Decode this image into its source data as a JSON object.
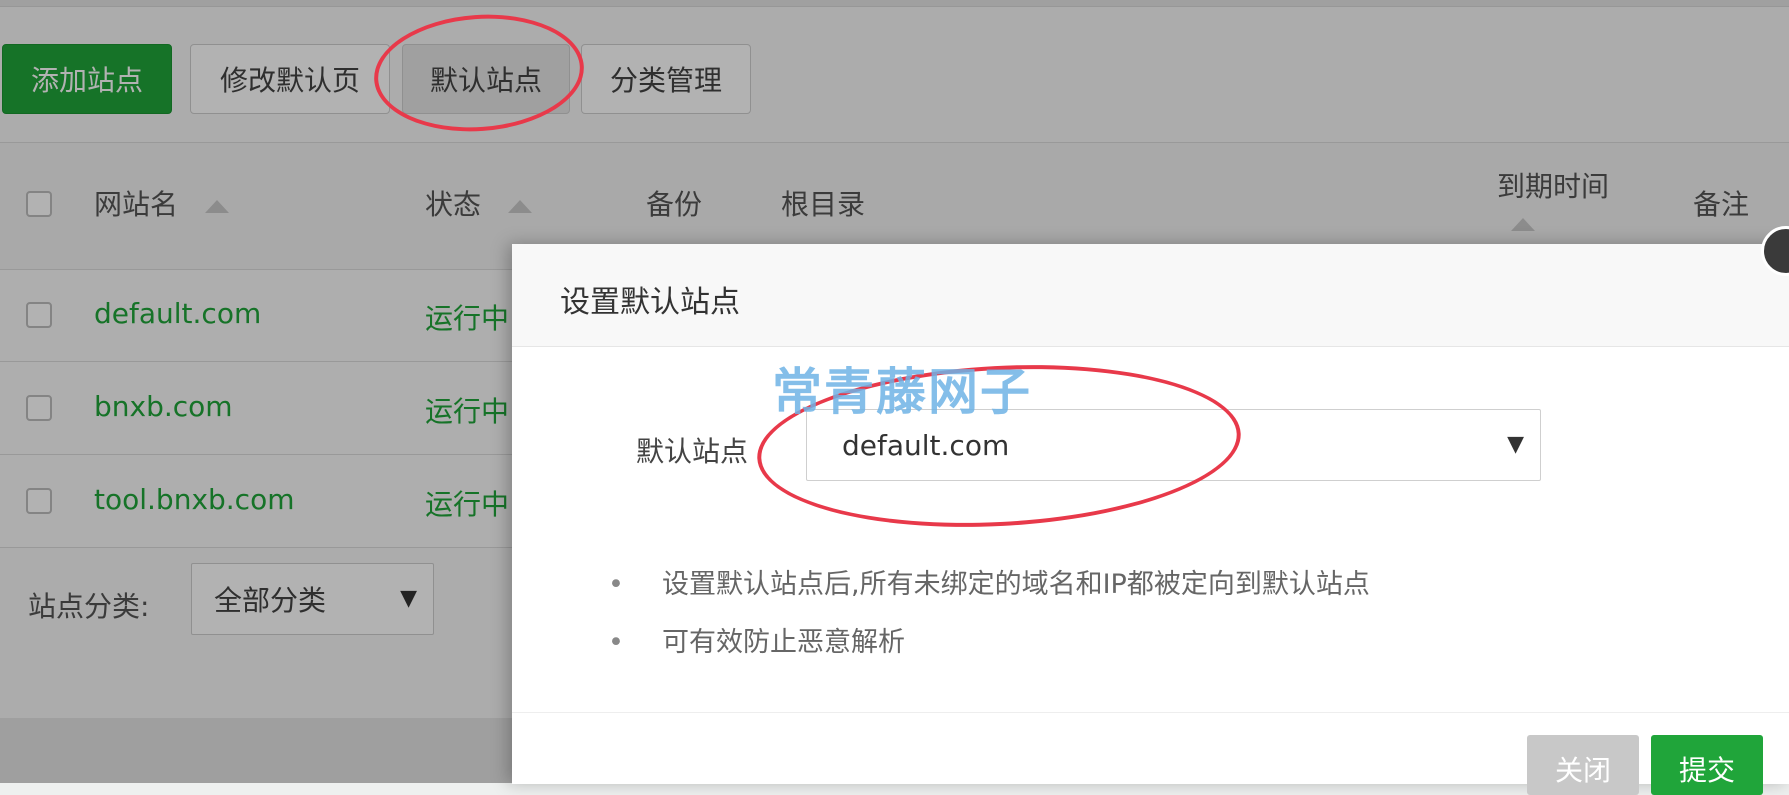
{
  "toolbar": {
    "add_site": "添加站点",
    "edit_default_page": "修改默认页",
    "default_site": "默认站点",
    "category_manage": "分类管理"
  },
  "table": {
    "columns": {
      "site_name": "网站名",
      "status": "状态",
      "backup": "备份",
      "root_dir": "根目录",
      "expire_time": "到期时间",
      "remark": "备注"
    },
    "rows": [
      {
        "name": "default.com",
        "status": "运行中"
      },
      {
        "name": "bnxb.com",
        "status": "运行中"
      },
      {
        "name": "tool.bnxb.com",
        "status": "运行中"
      }
    ]
  },
  "filter": {
    "label": "站点分类:",
    "selected": "全部分类"
  },
  "modal": {
    "title": "设置默认站点",
    "field_label": "默认站点",
    "field_value": "default.com",
    "tips": [
      "设置默认站点后,所有未绑定的域名和IP都被定向到默认站点",
      "可有效防止恶意解析"
    ],
    "close_button": "关闭",
    "submit_button": "提交"
  },
  "watermark": "常青藤网子",
  "colors": {
    "accent_green": "#20a53a",
    "annotation_red": "#e8394a",
    "watermark_blue": "#6fb3e6"
  },
  "icons": {
    "sort": "sort-up-icon",
    "dropdown": "caret-down-icon"
  }
}
